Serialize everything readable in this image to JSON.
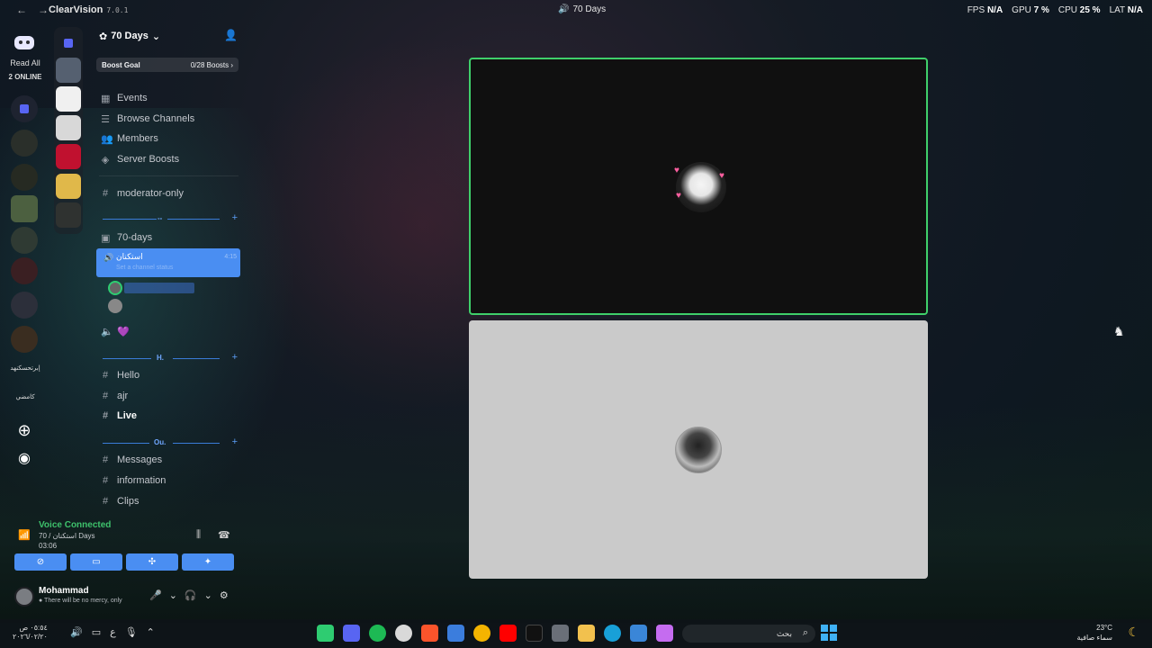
{
  "titlebar": {
    "app_name": "ClearVision",
    "version": "7.0.1",
    "window_title": "70 Days",
    "stats": {
      "fps_label": "FPS",
      "fps": "N/A",
      "gpu_label": "GPU",
      "gpu": "7 %",
      "cpu_label": "CPU",
      "cpu": "25 %",
      "lat_label": "LAT",
      "lat": "N/A"
    }
  },
  "rail": {
    "read_all": "Read All",
    "online": "2 ONLINE",
    "label_a": "إبرتحسكنهد",
    "label_b": "كامضي"
  },
  "guild": {
    "name": "70 Days",
    "boost_goal": "Boost Goal",
    "boost_count": "0/28 Boosts"
  },
  "sidebar": {
    "top_items": [
      "Events",
      "Browse Channels",
      "Members",
      "Server Boosts"
    ],
    "moderator": "moderator-only",
    "cat1_label": "--",
    "forum": "70-days",
    "voice_channel": {
      "name": "استكنان",
      "subtitle": "Set a channel status",
      "time": "4:15"
    },
    "voice_other": "💜",
    "cat2_label": "H.",
    "cat2_items": [
      "Hello",
      "ajr",
      "Live"
    ],
    "cat3_label": "Ou.",
    "cat3_items": [
      "Messages",
      "information",
      "Clips"
    ]
  },
  "voice_panel": {
    "title": "Voice Connected",
    "subtitle": "70 / استكنان Days",
    "timer": "03:06"
  },
  "user": {
    "name": "Mohammad",
    "status": "There will be no mercy, only"
  },
  "taskbar": {
    "time": "٠٥:٥٤ ص",
    "date": "٢٠٢٦/٠٢/٢٠",
    "lang": "ع",
    "search_placeholder": "بحث",
    "temp": "23°C",
    "weather": "سماء صافية"
  },
  "colors": {
    "accent": "#4a8ef2",
    "speaking": "#3fcf6a",
    "voice_green": "#3ec26c"
  }
}
